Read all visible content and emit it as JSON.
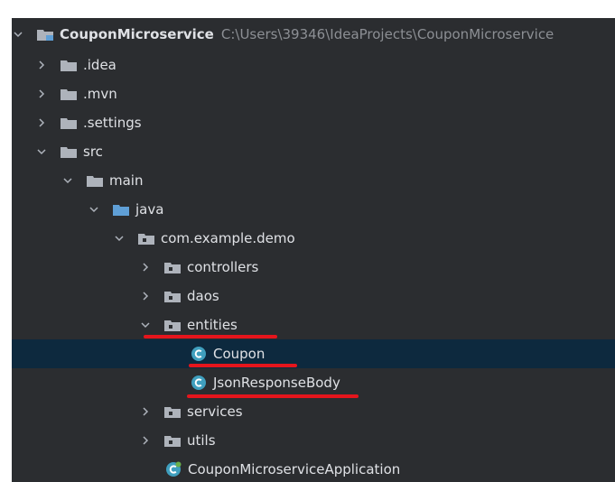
{
  "project": {
    "name": "CouponMicroservice",
    "path": "C:\\Users\\39346\\IdeaProjects\\CouponMicroservice"
  },
  "tree": {
    "idea": ".idea",
    "mvn": ".mvn",
    "settings": ".settings",
    "src": "src",
    "main": "main",
    "java": "java",
    "package": "com.example.demo",
    "controllers": "controllers",
    "daos": "daos",
    "entities": "entities",
    "coupon": "Coupon",
    "json_response_body": "JsonResponseBody",
    "services": "services",
    "utils": "utils",
    "application": "CouponMicroserviceApplication"
  },
  "colors": {
    "background": "#2b2d30",
    "selected_row": "#0d293e",
    "annotation_red": "#e5151c",
    "folder_gray": "#aeb3bb",
    "folder_blue": "#5f9fd6",
    "class_teal": "#3f9fbe",
    "spring_green": "#6ab04c"
  },
  "icons": {
    "expand": "chevron-down-icon",
    "collapse": "chevron-right-icon",
    "folder": "folder-icon",
    "package": "package-folder-icon",
    "class": "class-icon",
    "spring_class": "spring-boot-class-icon",
    "module": "module-folder-icon"
  }
}
